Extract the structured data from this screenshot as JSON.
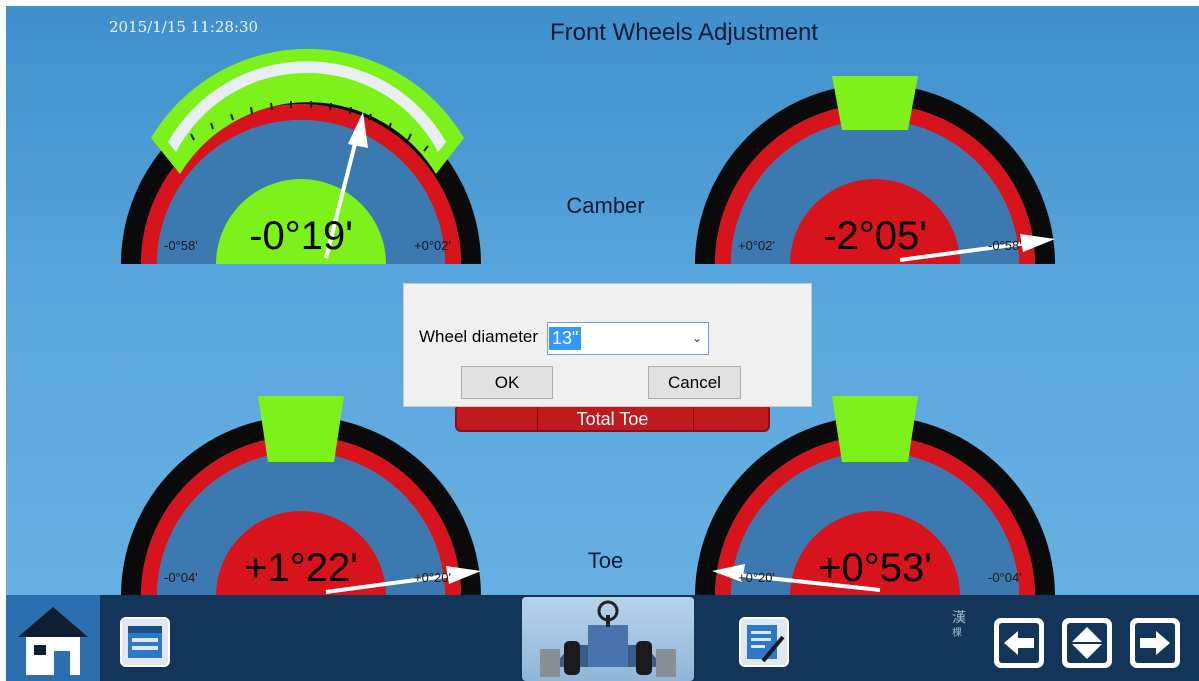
{
  "header": {
    "timestamp": "2015/1/15 11:28:30",
    "title": "Front Wheels Adjustment"
  },
  "sections": {
    "camber_label": "Camber",
    "toe_label": "Toe",
    "total_toe_label": "Total Toe"
  },
  "gauges": [
    {
      "id": "camber-left",
      "value": "-0°19'",
      "left_limit": "-0°58'",
      "right_limit": "+0°02'",
      "status": "in-range"
    },
    {
      "id": "camber-right",
      "value": "-2°05'",
      "left_limit": "+0°02'",
      "right_limit": "-0°58'",
      "status": "out-of-range"
    },
    {
      "id": "toe-left",
      "value": "+1°22'",
      "left_limit": "-0°04'",
      "right_limit": "+0°20'",
      "status": "out-of-range"
    },
    {
      "id": "toe-right",
      "value": "+0°53'",
      "left_limit": "+0°20'",
      "right_limit": "-0°04'",
      "status": "out-of-range"
    }
  ],
  "dialog": {
    "label": "Wheel diameter",
    "selected_value": "13\"",
    "ok_label": "OK",
    "cancel_label": "Cancel"
  },
  "bottom_bar": {
    "language_glyph": "漢",
    "language_sub": "棵"
  },
  "colors": {
    "in_range": "#7cf21a",
    "out_of_range": "#d7141b",
    "bezel": "#0a0a0a",
    "bottom_bar": "#13355a"
  }
}
